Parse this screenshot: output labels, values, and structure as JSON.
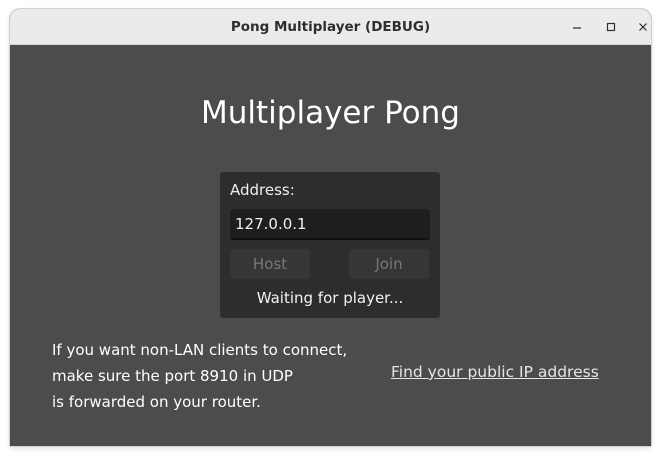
{
  "window": {
    "title": "Pong Multiplayer (DEBUG)",
    "controls": {
      "minimize": "–",
      "maximize": "□",
      "close": "✕"
    }
  },
  "main": {
    "heading": "Multiplayer Pong",
    "address_label": "Address:",
    "address_value": "127.0.0.1",
    "host_label": "Host",
    "join_label": "Join",
    "status": "Waiting for player...",
    "info_lines": [
      "If you want non-LAN clients to connect,",
      "make sure the port 8910 in UDP",
      "is forwarded on your router."
    ],
    "ip_link": "Find your public IP address"
  },
  "colors": {
    "background": "#4c4c4c",
    "panel": "#2d2d2d",
    "input": "#1e1e1e",
    "titlebar": "#ebebeb"
  }
}
